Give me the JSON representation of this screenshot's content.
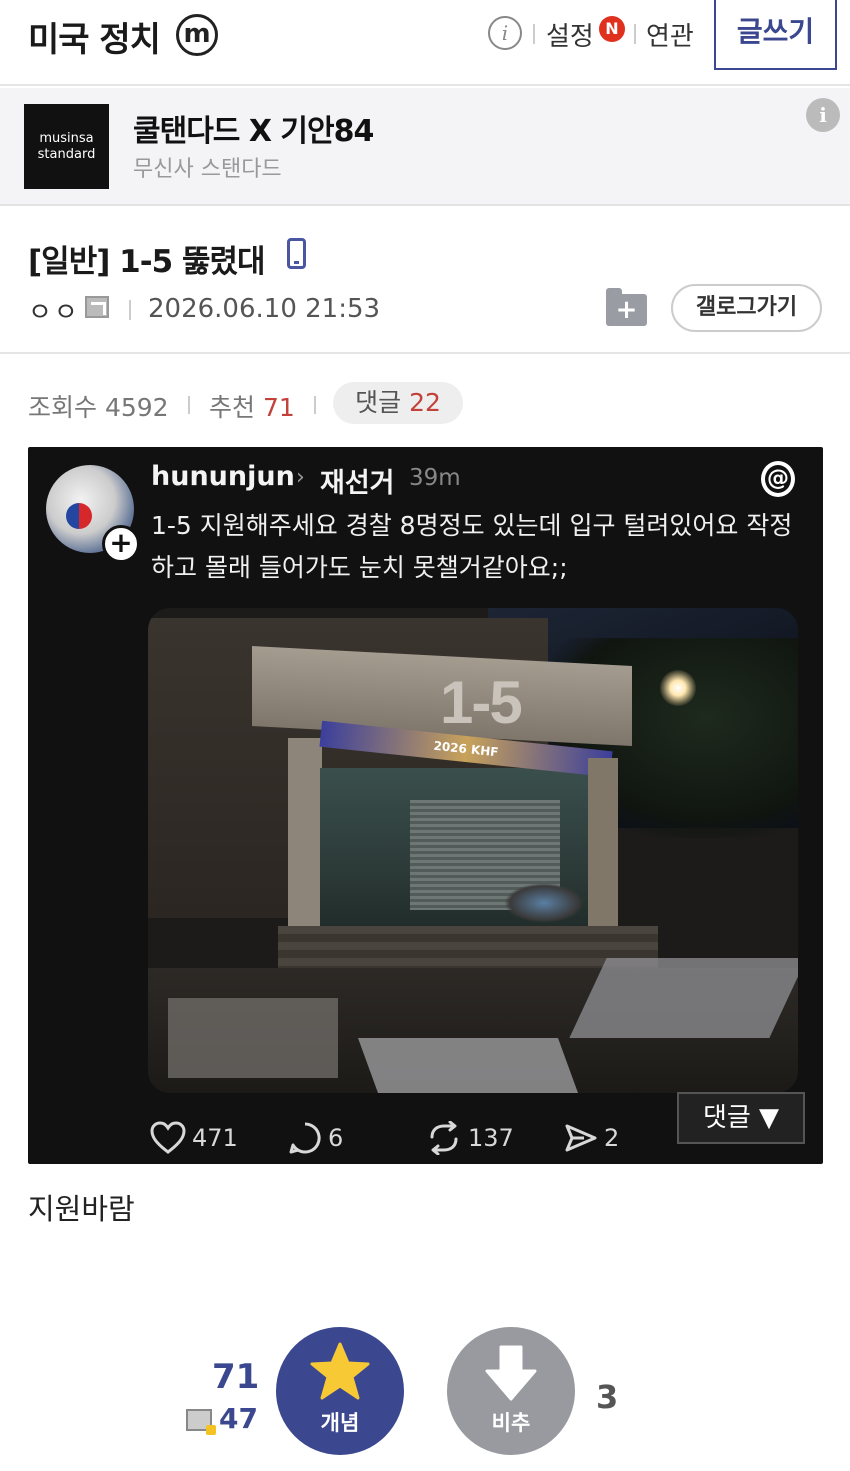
{
  "header": {
    "gallery_title": "미국 정치",
    "minor_badge": "m",
    "settings_label": "설정",
    "new_badge": "N",
    "related_label": "연관",
    "write_label": "글쓰기"
  },
  "ad": {
    "logo_line1": "musinsa",
    "logo_line2": "standard",
    "title": "쿨탠다드 X 기안84",
    "subtitle": "무신사 스탠다드"
  },
  "post": {
    "title": "[일반] 1-5 뚫렸대",
    "author": "ㅇㅇ",
    "date": "2026.06.10 21:53",
    "gallery_button": "갤로그가기",
    "body": "지원바람"
  },
  "stats": {
    "views_label": "조회수",
    "views": "4592",
    "recommend_label": "추천",
    "recommend": "71",
    "comments_label": "댓글",
    "comments": "22"
  },
  "embed": {
    "username": "hununjun",
    "topic": "재선거",
    "time_ago": "39m",
    "text": "1-5 지원해주세요 경찰 8명정도 있는데 입구 털려있어요 작정하고 몰래 들어가도 눈치 못챌거같아요;;",
    "photo_sign": "1-5",
    "photo_banner": "2026 KHF",
    "likes": "471",
    "replies": "6",
    "reposts": "137",
    "shares": "2",
    "comment_toggle": "댓글 ▼"
  },
  "votes": {
    "up_count": "71",
    "fixed_count": "47",
    "up_label": "개념",
    "down_label": "비추",
    "down_count": "3"
  },
  "colors": {
    "brand": "#3b4890",
    "accent_red": "#c2413b",
    "new_badge": "#e0301e"
  }
}
